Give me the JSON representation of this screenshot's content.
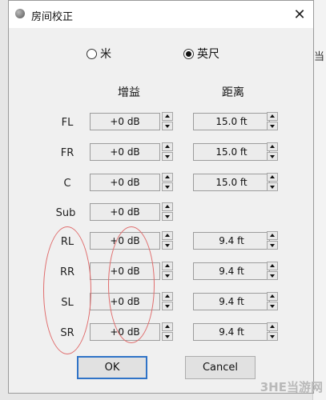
{
  "background": {
    "edge_glyph": "当"
  },
  "dialog": {
    "title": "房间校正",
    "close_symbol": "✕",
    "app_icon": "speaker-icon"
  },
  "units": {
    "options": [
      {
        "label": "米",
        "selected": false
      },
      {
        "label": "英尺",
        "selected": true
      }
    ]
  },
  "headers": {
    "gain": "增益",
    "distance": "距离"
  },
  "channels": [
    {
      "label": "FL",
      "gain": "+0 dB",
      "distance": "15.0 ft"
    },
    {
      "label": "FR",
      "gain": "+0 dB",
      "distance": "15.0 ft"
    },
    {
      "label": "C",
      "gain": "+0 dB",
      "distance": "15.0 ft"
    },
    {
      "label": "Sub",
      "gain": "+0 dB",
      "distance": ""
    },
    {
      "label": "RL",
      "gain": "+0 dB",
      "distance": "9.4 ft"
    },
    {
      "label": "RR",
      "gain": "+0 dB",
      "distance": "9.4 ft"
    },
    {
      "label": "SL",
      "gain": "+0 dB",
      "distance": "9.4 ft"
    },
    {
      "label": "SR",
      "gain": "+0 dB",
      "distance": "9.4 ft"
    }
  ],
  "buttons": {
    "ok": "OK",
    "cancel": "Cancel"
  },
  "annotation_color": "#e06c6c",
  "watermark": "3HE当游网"
}
